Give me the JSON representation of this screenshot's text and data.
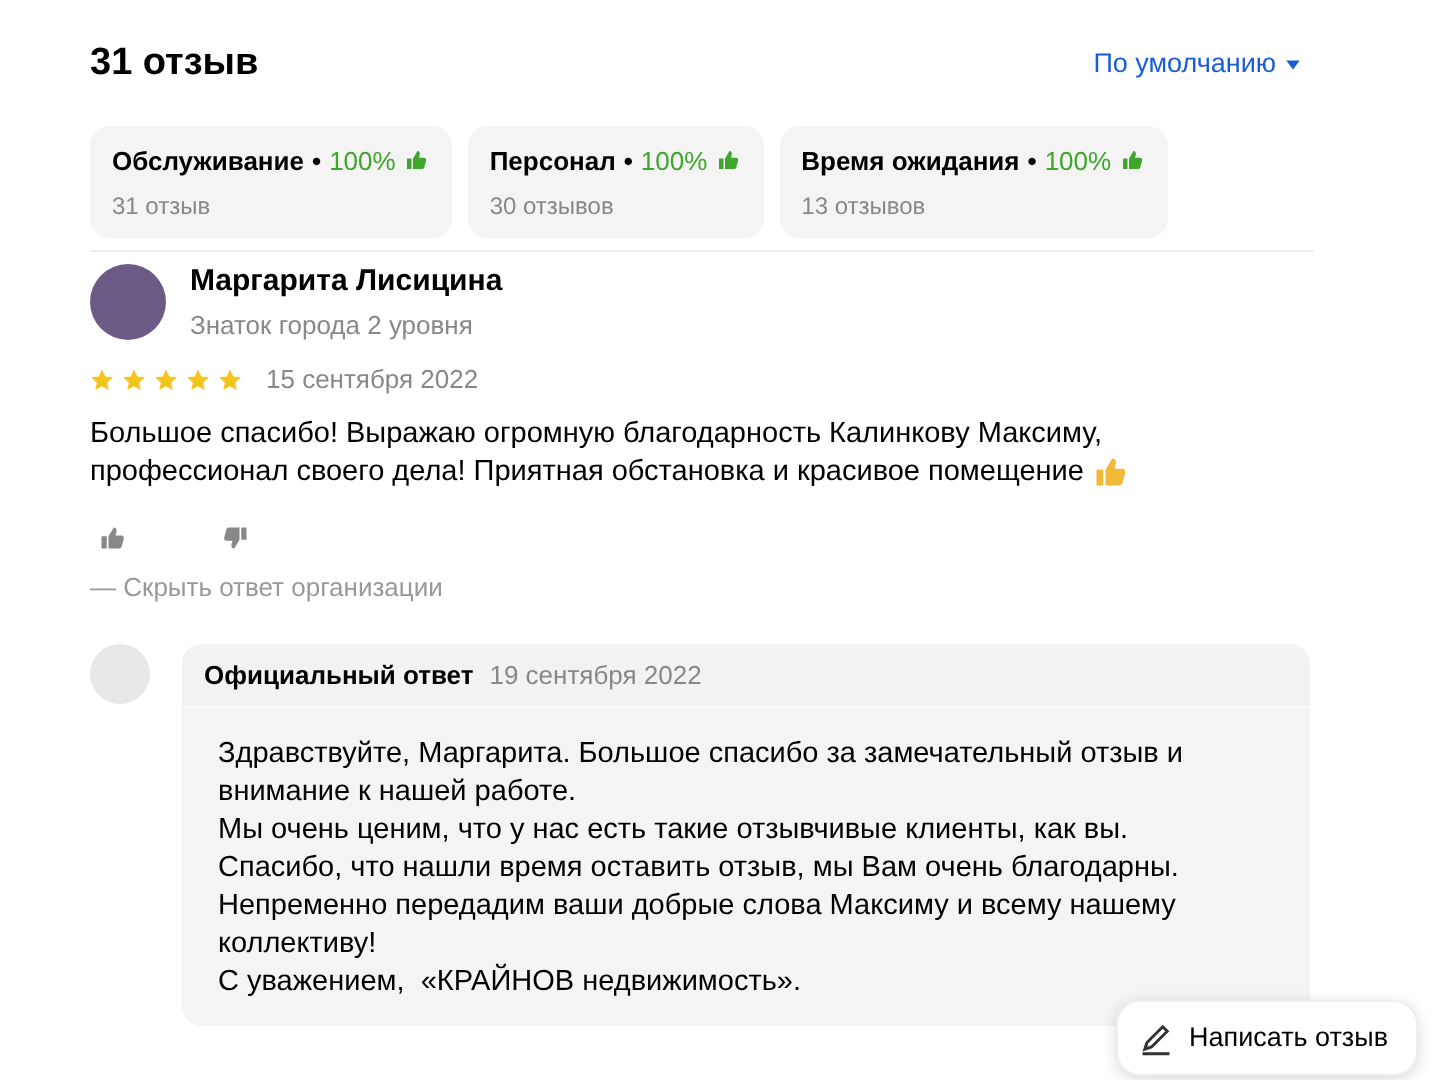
{
  "header": {
    "title": "31 отзыв",
    "sort": "По умолчанию"
  },
  "aspects": [
    {
      "name": "Обслуживание",
      "separator": "•",
      "percent": "100%",
      "count": "31 отзыв"
    },
    {
      "name": "Персонал",
      "separator": "•",
      "percent": "100%",
      "count": "30 отзывов"
    },
    {
      "name": "Время ожидания",
      "separator": "•",
      "percent": "100%",
      "count": "13 отзывов"
    }
  ],
  "review": {
    "author": "Маргарита Лисицина",
    "author_level": "Знаток города 2 уровня",
    "stars": 5,
    "date": "15 сентября 2022",
    "text": "Большое спасибо! Выражаю огромную благодарность Калинкову Максиму, профессионал своего дела! Приятная обстановка и красивое помещение",
    "hide_reply": "— Скрыть ответ организации"
  },
  "reply": {
    "label": "Официальный ответ",
    "date": "19 сентября 2022",
    "lines": [
      "Здравствуйте, Маргарита. Большое спасибо за замечательный отзыв и внимание к нашей работе.",
      "Мы очень ценим, что у нас есть такие отзывчивые клиенты, как вы.",
      "Спасибо, что нашли время оставить отзыв, мы Вам очень благодарны.",
      "Непременно передадим ваши добрые слова Максиму и всему нашему коллективу!",
      "С уважением,  «КРАЙНОВ недвижимость»."
    ]
  },
  "write_button": "Написать отзыв"
}
